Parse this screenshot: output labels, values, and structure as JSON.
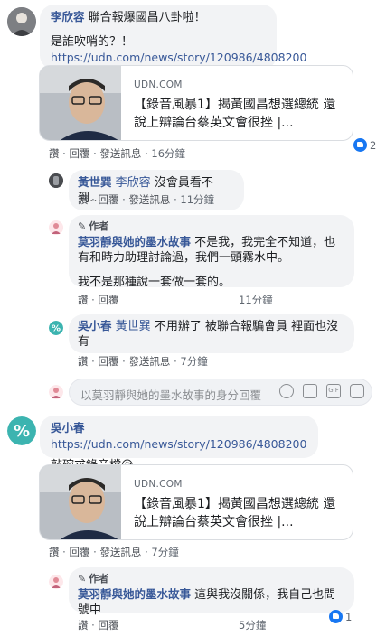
{
  "c1": {
    "name": "李欣容",
    "text1": "聯合報爆國昌八卦啦！",
    "text2": "是誰吹哨的？！",
    "link": "https://udn.com/news/story/120986/4808200",
    "card": {
      "domain": "UDN.COM",
      "title": "【錄音風暴1】揭黃國昌想選總統 還說上辯論台蔡英文會很挫 |..."
    },
    "actions": [
      "讚",
      "回覆",
      "發送訊息",
      "16分鐘"
    ],
    "reaction_count": "2"
  },
  "r1": {
    "name": "黃世巽",
    "mention": "李欣容",
    "text": "沒會員看不到…",
    "actions": [
      "讚",
      "回覆",
      "發送訊息",
      "11分鐘"
    ]
  },
  "r2": {
    "badge": "作者",
    "name": "莫羽靜與她的墨水故事",
    "text1": "不是我，我完全不知道，也有和時力助理討論過，我們一頭霧水中。",
    "text2": "我不是那種說一套做一套的。",
    "actions": [
      "讚",
      "回覆",
      "11分鐘"
    ]
  },
  "r3": {
    "name": "吳小春",
    "mention": "黃世巽",
    "text": "不用辦了 被聯合報騙會員 裡面也沒有",
    "actions": [
      "讚",
      "回覆",
      "發送訊息",
      "7分鐘"
    ]
  },
  "reply_input": {
    "placeholder": "以莫羽靜與她的墨水故事的身分回覆"
  },
  "c2": {
    "name": "吳小春",
    "link": "https://udn.com/news/story/120986/4808200",
    "text": "敲碗求錄音檔😥",
    "card": {
      "domain": "UDN.COM",
      "title": "【錄音風暴1】揭黃國昌想選總統 還說上辯論台蔡英文會很挫 |..."
    },
    "actions": [
      "讚",
      "回覆",
      "發送訊息",
      "7分鐘"
    ]
  },
  "r4": {
    "badge": "作者",
    "name": "莫羽靜與她的墨水故事",
    "text": "這與我沒關係，我自己也問號中",
    "actions": [
      "讚",
      "回覆",
      "5分鐘"
    ],
    "reaction_count": "1"
  }
}
